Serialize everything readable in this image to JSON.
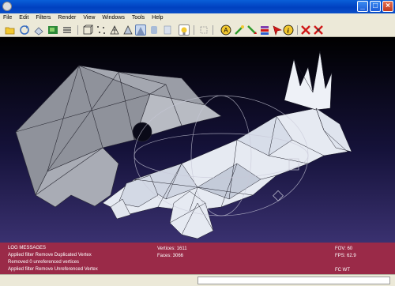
{
  "menu": {
    "items": [
      "File",
      "Edit",
      "Filters",
      "Render",
      "View",
      "Windows",
      "Tools",
      "Help"
    ]
  },
  "toolbar": {
    "icons": [
      "open-folder-icon",
      "reload-icon",
      "save-icon",
      "snapshot-icon",
      "layers-icon",
      "bounding-box-icon",
      "points-icon",
      "wireframe-icon",
      "flat-lines-icon",
      "flat-icon",
      "smooth-icon",
      "texture-icon",
      "light-icon",
      "select-faces-icon",
      "annotation-icon",
      "measure-icon",
      "paint-icon",
      "align-icon",
      "pick-icon",
      "info-icon",
      "delete-faces-icon",
      "delete-vertices-icon"
    ],
    "colors": {
      "yellow": "#F2C830",
      "green": "#2E9A2A",
      "red": "#D01818",
      "blue": "#3060D0",
      "purple": "#8040B0"
    }
  },
  "viewport": {
    "background_top": "#000000",
    "background_bottom": "#3A3170",
    "mesh_color": "#E6EAF2"
  },
  "log": {
    "header": "LOG MESSAGES",
    "lines": [
      "Applied filter Remove Duplicated Vertex",
      "Removed 0 unreferenced vertices",
      "Applied filter Remove Unreferenced Vertex"
    ]
  },
  "stats": {
    "vertices": "Vertices: 1611",
    "faces": "Faces: 3066",
    "fov": "FOV: 60",
    "fps": "FPS:   62.9",
    "fc": "FC WT"
  },
  "panel_color": "#9A2A48"
}
